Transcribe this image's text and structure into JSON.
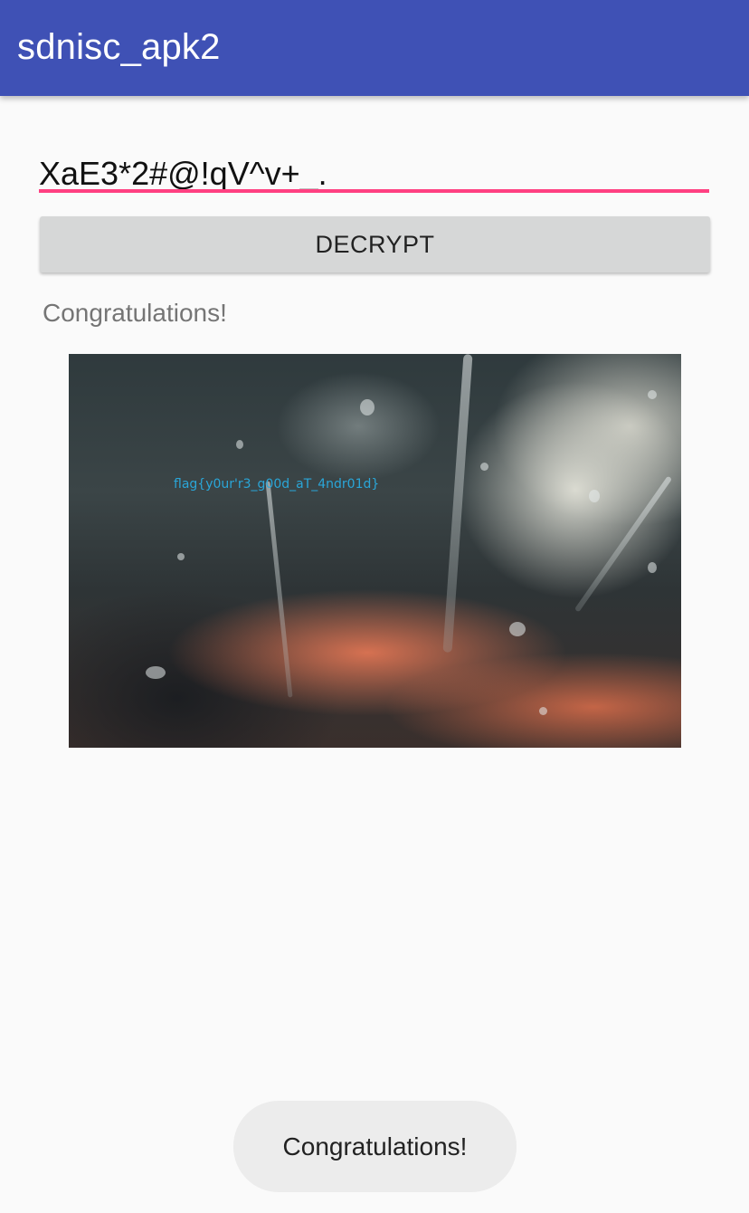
{
  "app_bar": {
    "title": "sdnisc_apk2",
    "color": "#3f51b5"
  },
  "input": {
    "value": "XaE3*2#@!qV^v+_.",
    "underline_color": "#ff4081"
  },
  "decrypt_button": {
    "label": "DECRYPT"
  },
  "result": {
    "text": "Congratulations!"
  },
  "image": {
    "overlay_text": "flag{y0ur'r3_g00d_aT_4ndr01d}"
  },
  "toast": {
    "text": "Congratulations!"
  }
}
